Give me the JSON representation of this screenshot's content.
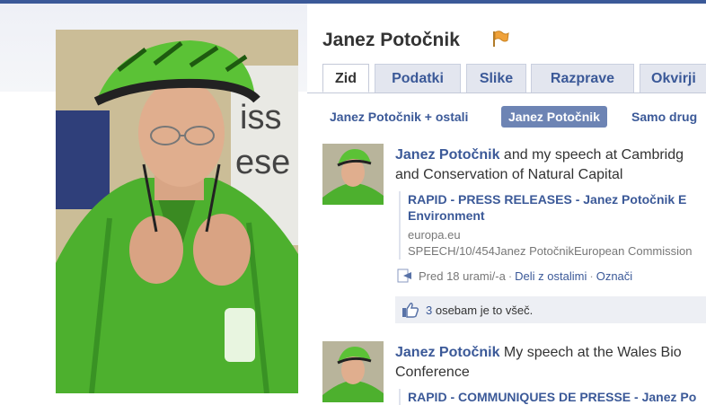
{
  "profile": {
    "name": "Janez Potočnik"
  },
  "tabs": [
    {
      "label": "Zid",
      "active": true
    },
    {
      "label": "Podatki",
      "active": false
    },
    {
      "label": "Slike",
      "active": false
    },
    {
      "label": "Razprave",
      "active": false
    },
    {
      "label": "Okvirji",
      "active": false
    }
  ],
  "filters": [
    {
      "label": "Janez Potočnik + ostali",
      "active": false
    },
    {
      "label": "Janez Potočnik",
      "active": true
    },
    {
      "label": "Samo drug",
      "active": false
    }
  ],
  "posts": [
    {
      "author": "Janez Potočnik",
      "text_line1": " and my speech at Cambridg",
      "text_line2": "and Conservation of Natural Capital",
      "attachment": {
        "title_line1": "RAPID - PRESS RELEASES - Janez Potočnik E",
        "title_line2": "Environment",
        "domain": "europa.eu",
        "description": "SPEECH/10/454Janez PotočnikEuropean Commission"
      },
      "meta": {
        "time": "Pred 18 urami/-a",
        "share": "Deli z ostalimi",
        "tag": "Označi"
      },
      "likes": {
        "count": "3",
        "text": " osebam je to všeč."
      }
    },
    {
      "author": "Janez Potočnik",
      "text_line1": " My speech at the Wales Bio",
      "text_line2": "Conference",
      "attachment": {
        "title_line1": "RAPID - COMMUNIQUES DE PRESSE - Janez Po"
      }
    }
  ],
  "colors": {
    "link": "#3b5998",
    "active_filter": "#6d84b4",
    "helmet_green": "#5bc236",
    "jacket_green": "#4db02e"
  }
}
